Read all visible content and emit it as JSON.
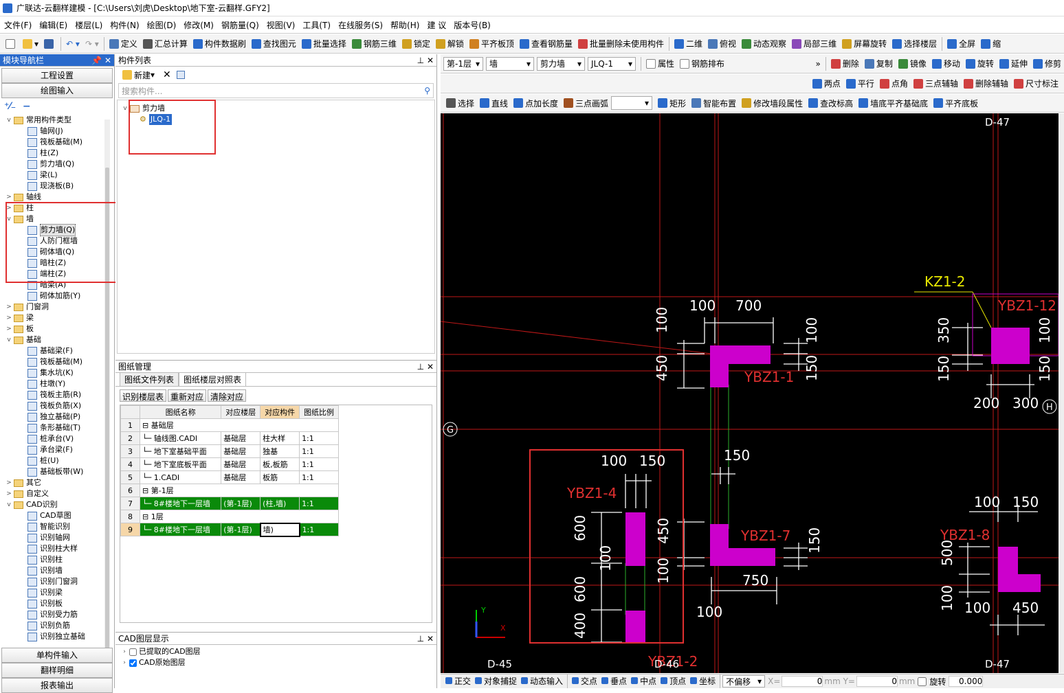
{
  "window": {
    "title": "广联达-云翻样建模 - [C:\\Users\\刘虎\\Desktop\\地下室-云翻样.GFY2]"
  },
  "menu": [
    "文件(F)",
    "编辑(E)",
    "楼层(L)",
    "构件(N)",
    "绘图(D)",
    "修改(M)",
    "钢筋量(Q)",
    "视图(V)",
    "工具(T)",
    "在线服务(S)",
    "帮助(H)",
    "建 议",
    "版本号(B)"
  ],
  "toolbar1": [
    "定义",
    "汇总计算",
    "构件数据刷",
    "查找图元",
    "批量选择",
    "钢筋三维",
    "锁定",
    "解锁",
    "平齐板顶",
    "查看钢筋量",
    "批量删除未使用构件",
    "二维",
    "俯视",
    "动态观察",
    "局部三维",
    "屏幕旋转",
    "选择楼层",
    "全屏",
    "缩"
  ],
  "nav": {
    "title": "模块导航栏",
    "btn_settings": "工程设置",
    "btn_draw": "绘图输入",
    "items": [
      {
        "label": "常用构件类型",
        "lvl": 0,
        "type": "folder",
        "exp": "v"
      },
      {
        "label": "轴网(J)",
        "lvl": 1,
        "type": "leaf"
      },
      {
        "label": "筏板基础(M)",
        "lvl": 1,
        "type": "leaf"
      },
      {
        "label": "柱(Z)",
        "lvl": 1,
        "type": "leaf"
      },
      {
        "label": "剪力墙(Q)",
        "lvl": 1,
        "type": "leaf"
      },
      {
        "label": "梁(L)",
        "lvl": 1,
        "type": "leaf"
      },
      {
        "label": "现浇板(B)",
        "lvl": 1,
        "type": "leaf"
      },
      {
        "label": "轴线",
        "lvl": 0,
        "type": "folder",
        "exp": ">"
      },
      {
        "label": "柱",
        "lvl": 0,
        "type": "folder",
        "exp": ">"
      },
      {
        "label": "墙",
        "lvl": 0,
        "type": "folder",
        "exp": "v"
      },
      {
        "label": "剪力墙(Q)",
        "lvl": 1,
        "type": "leaf",
        "sel": true
      },
      {
        "label": "人防门框墙",
        "lvl": 1,
        "type": "leaf"
      },
      {
        "label": "砌体墙(Q)",
        "lvl": 1,
        "type": "leaf"
      },
      {
        "label": "暗柱(Z)",
        "lvl": 1,
        "type": "leaf"
      },
      {
        "label": "端柱(Z)",
        "lvl": 1,
        "type": "leaf"
      },
      {
        "label": "暗梁(A)",
        "lvl": 1,
        "type": "leaf"
      },
      {
        "label": "砌体加筋(Y)",
        "lvl": 1,
        "type": "leaf"
      },
      {
        "label": "门窗洞",
        "lvl": 0,
        "type": "folder",
        "exp": ">"
      },
      {
        "label": "梁",
        "lvl": 0,
        "type": "folder",
        "exp": ">"
      },
      {
        "label": "板",
        "lvl": 0,
        "type": "folder",
        "exp": ">"
      },
      {
        "label": "基础",
        "lvl": 0,
        "type": "folder",
        "exp": "v"
      },
      {
        "label": "基础梁(F)",
        "lvl": 1,
        "type": "leaf"
      },
      {
        "label": "筏板基础(M)",
        "lvl": 1,
        "type": "leaf"
      },
      {
        "label": "集水坑(K)",
        "lvl": 1,
        "type": "leaf"
      },
      {
        "label": "柱墩(Y)",
        "lvl": 1,
        "type": "leaf"
      },
      {
        "label": "筏板主筋(R)",
        "lvl": 1,
        "type": "leaf"
      },
      {
        "label": "筏板负筋(X)",
        "lvl": 1,
        "type": "leaf"
      },
      {
        "label": "独立基础(P)",
        "lvl": 1,
        "type": "leaf"
      },
      {
        "label": "条形基础(T)",
        "lvl": 1,
        "type": "leaf"
      },
      {
        "label": "桩承台(V)",
        "lvl": 1,
        "type": "leaf"
      },
      {
        "label": "承台梁(F)",
        "lvl": 1,
        "type": "leaf"
      },
      {
        "label": "桩(U)",
        "lvl": 1,
        "type": "leaf"
      },
      {
        "label": "基础板带(W)",
        "lvl": 1,
        "type": "leaf"
      },
      {
        "label": "其它",
        "lvl": 0,
        "type": "folder",
        "exp": ">"
      },
      {
        "label": "自定义",
        "lvl": 0,
        "type": "folder",
        "exp": ">"
      },
      {
        "label": "CAD识别",
        "lvl": 0,
        "type": "folder",
        "exp": "v"
      },
      {
        "label": "CAD草图",
        "lvl": 1,
        "type": "leaf"
      },
      {
        "label": "智能识别",
        "lvl": 1,
        "type": "leaf"
      },
      {
        "label": "识别轴网",
        "lvl": 1,
        "type": "leaf"
      },
      {
        "label": "识别柱大样",
        "lvl": 1,
        "type": "leaf"
      },
      {
        "label": "识别柱",
        "lvl": 1,
        "type": "leaf"
      },
      {
        "label": "识别墙",
        "lvl": 1,
        "type": "leaf"
      },
      {
        "label": "识别门窗洞",
        "lvl": 1,
        "type": "leaf"
      },
      {
        "label": "识别梁",
        "lvl": 1,
        "type": "leaf"
      },
      {
        "label": "识别板",
        "lvl": 1,
        "type": "leaf"
      },
      {
        "label": "识别受力筋",
        "lvl": 1,
        "type": "leaf"
      },
      {
        "label": "识别负筋",
        "lvl": 1,
        "type": "leaf"
      },
      {
        "label": "识别独立基础",
        "lvl": 1,
        "type": "leaf"
      }
    ],
    "btn_single": "单构件输入",
    "btn_detail": "翻样明细",
    "btn_report": "报表输出"
  },
  "complist": {
    "title": "构件列表",
    "new_label": "新建",
    "search_placeholder": "搜索构件...",
    "group": "剪力墙",
    "item": "JLQ-1"
  },
  "drawmgr": {
    "title": "图纸管理",
    "tabs": [
      "图纸文件列表",
      "图纸楼层对照表"
    ],
    "buttons": [
      "识别楼层表",
      "重新对应",
      "清除对应"
    ],
    "headers": [
      "",
      "图纸名称",
      "对应楼层",
      "对应构件",
      "图纸比例"
    ],
    "rows": [
      {
        "n": "1",
        "name": "基础层",
        "floor": "",
        "comp": "",
        "scale": "",
        "group": true
      },
      {
        "n": "2",
        "name": "轴线图.CADI",
        "floor": "基础层",
        "comp": "柱大样",
        "scale": "1:1"
      },
      {
        "n": "3",
        "name": "地下室基础平面",
        "floor": "基础层",
        "comp": "独基",
        "scale": "1:1"
      },
      {
        "n": "4",
        "name": "地下室底板平面",
        "floor": "基础层",
        "comp": "板,板筋",
        "scale": "1:1"
      },
      {
        "n": "5",
        "name": "1.CADI",
        "floor": "基础层",
        "comp": "板筋",
        "scale": "1:1"
      },
      {
        "n": "6",
        "name": "第-1层",
        "floor": "",
        "comp": "",
        "scale": "",
        "group": true
      },
      {
        "n": "7",
        "name": "8#楼地下一层墙",
        "floor": "(第-1层)",
        "comp": "(柱,墙)",
        "scale": "1:1",
        "green": true
      },
      {
        "n": "8",
        "name": "1层",
        "floor": "",
        "comp": "",
        "scale": "",
        "group": true
      },
      {
        "n": "9",
        "name": "8#楼地下一层墙",
        "floor": "(第-1层)",
        "comp": "墙)",
        "scale": "1:1",
        "green": true,
        "edit": true
      }
    ]
  },
  "cadlayer": {
    "title": "CAD图层显示",
    "items": [
      "已提取的CAD图层",
      "CAD原始图层"
    ]
  },
  "rtb1": {
    "floor": "第-1层",
    "type": "墙",
    "sub": "剪力墙",
    "comp": "JLQ-1",
    "attr": "属性",
    "rebar": "钢筋排布",
    "tools": [
      "删除",
      "复制",
      "镜像",
      "移动",
      "旋转",
      "延伸",
      "修剪"
    ]
  },
  "rtb2": [
    "两点",
    "平行",
    "点角",
    "三点辅轴",
    "删除辅轴",
    "尺寸标注"
  ],
  "rtb3": [
    "选择",
    "直线",
    "点加长度",
    "三点画弧",
    "矩形",
    "智能布置",
    "修改墙段属性",
    "查改标高",
    "墙底平齐基础底",
    "平齐底板"
  ],
  "status": {
    "items": [
      "正交",
      "对象捕捉",
      "动态输入",
      "交点",
      "垂点",
      "中点",
      "顶点",
      "坐标"
    ],
    "offset": "不偏移",
    "x_label": "X=",
    "x_val": "0",
    "y_label": "mm Y=",
    "y_val": "0",
    "mm": "mm",
    "rotate": "旋转",
    "rot_val": "0.000"
  },
  "cad": {
    "labels": [
      "D-47",
      "KZ1-2",
      "YBZ1-12",
      "YBZ1-1",
      "YBZ1-4",
      "YBZ1-7",
      "YBZ1-8",
      "YBZ1-2",
      "D-45",
      "D-46",
      "D-47",
      "G",
      "H"
    ],
    "dims": [
      "100",
      "700",
      "100",
      "450",
      "100",
      "150",
      "350",
      "150",
      "100",
      "150",
      "200",
      "300",
      "150",
      "100",
      "150",
      "600",
      "100",
      "450",
      "100",
      "600",
      "400",
      "150",
      "750",
      "100",
      "100",
      "150",
      "500",
      "100",
      "100",
      "450"
    ]
  },
  "colors": {
    "accent": "#2a6acb",
    "green_row": "#0a8a0a",
    "magenta": "#cc00cc",
    "red_box": "#e03030"
  }
}
